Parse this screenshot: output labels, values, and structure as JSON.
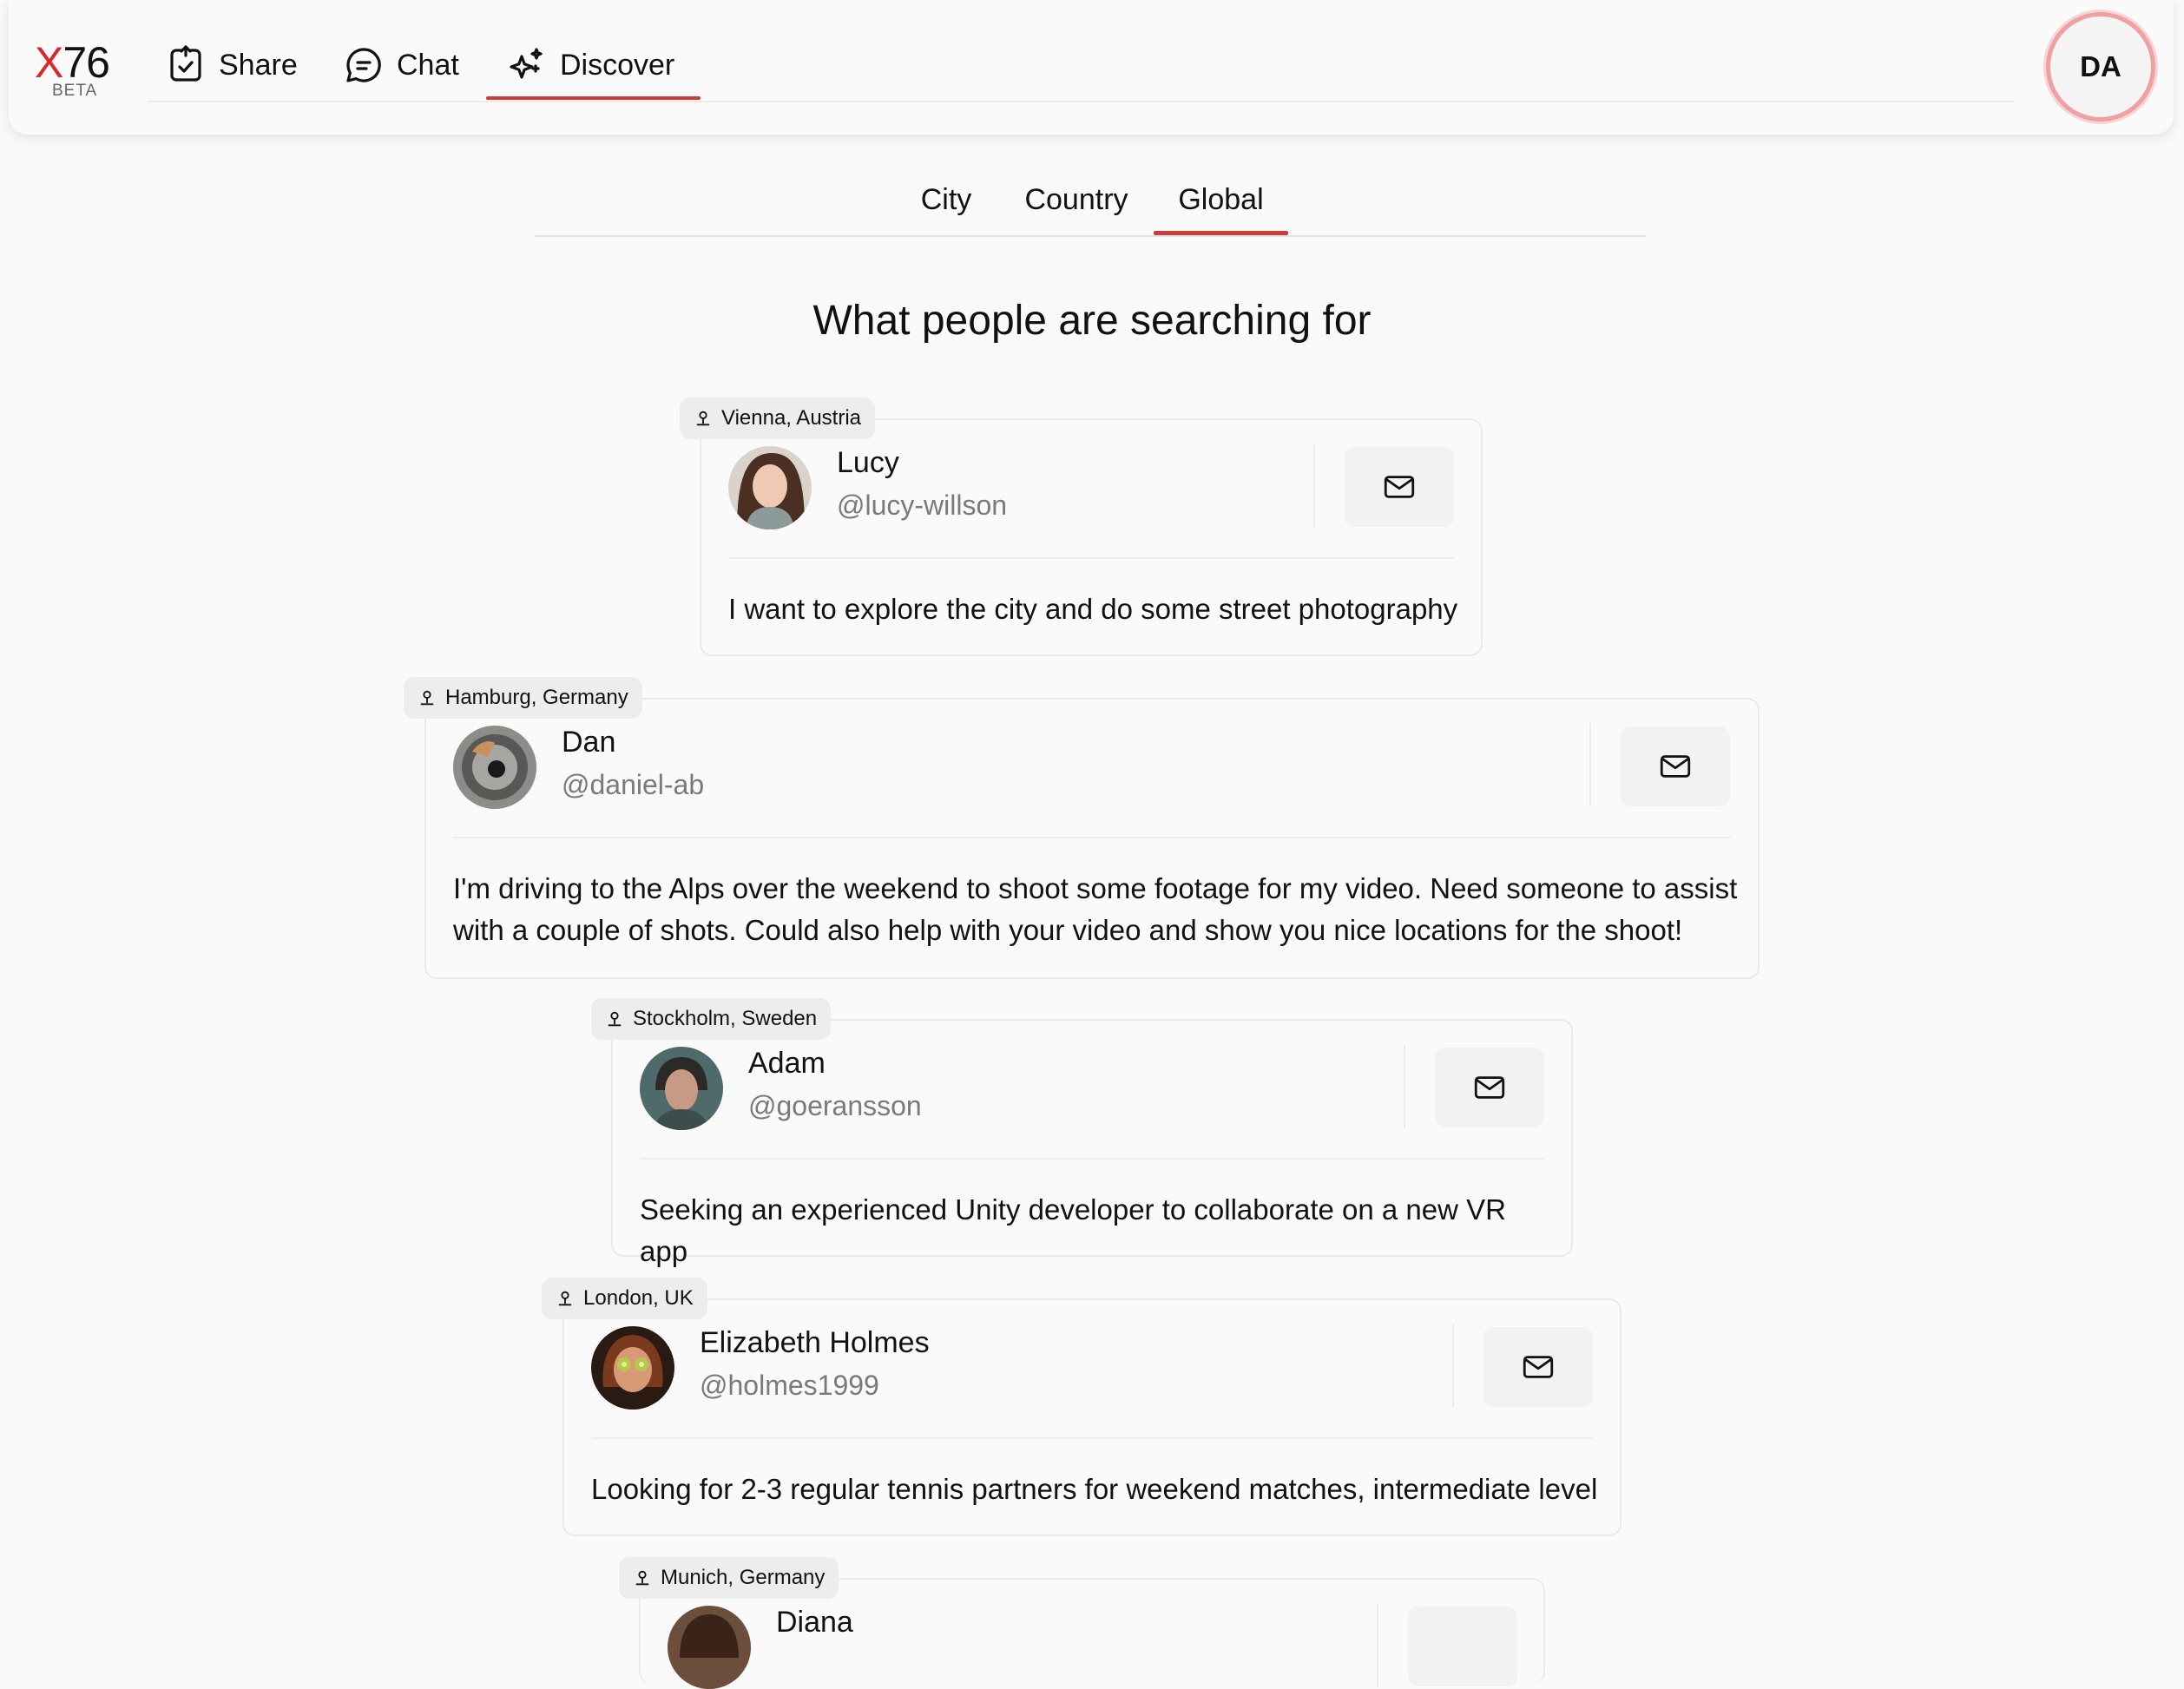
{
  "app": {
    "logo_x": "X",
    "logo_num": "76",
    "logo_beta": "BETA",
    "accent_color": "#d23a3a"
  },
  "nav": {
    "items": [
      {
        "label": "Share",
        "icon": "share-check-icon"
      },
      {
        "label": "Chat",
        "icon": "chat-bubble-icon"
      },
      {
        "label": "Discover",
        "icon": "sparkles-icon",
        "active": true
      }
    ]
  },
  "user": {
    "initials": "DA"
  },
  "tabs": {
    "items": [
      {
        "label": "City"
      },
      {
        "label": "Country"
      },
      {
        "label": "Global",
        "active": true
      }
    ]
  },
  "heading": "What people are searching for",
  "cards": [
    {
      "location": "Vienna, Austria",
      "name": "Lucy",
      "handle": "@lucy-willson",
      "message": "I want to explore the city and do some street photography"
    },
    {
      "location": "Hamburg, Germany",
      "name": "Dan",
      "handle": "@daniel-ab",
      "message": "I'm driving to the Alps over the weekend to shoot some footage for my video. Need someone to assist with a couple of shots. Could also help with your video and show you nice locations for the shoot!"
    },
    {
      "location": "Stockholm, Sweden",
      "name": "Adam",
      "handle": "@goeransson",
      "message": "Seeking an experienced Unity developer to collaborate on a new VR app"
    },
    {
      "location": "London, UK",
      "name": "Elizabeth Holmes",
      "handle": "@holmes1999",
      "message": "Looking for 2-3 regular tennis partners for weekend matches, intermediate level"
    },
    {
      "location": "Munich, Germany",
      "name": "Diana",
      "handle": "",
      "message": ""
    }
  ]
}
